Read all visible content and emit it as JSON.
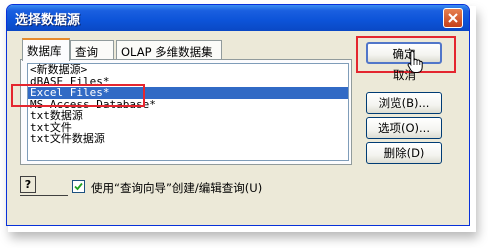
{
  "window": {
    "title": "选择数据源"
  },
  "tabs": [
    {
      "label": "数据库",
      "mnemonic": "D",
      "active": true
    },
    {
      "label": "查询",
      "mnemonic": "Q",
      "active": false
    },
    {
      "label": "OLAP 多维数据集",
      "mnemonic": "O",
      "active": false
    }
  ],
  "data_sources": [
    {
      "label": "<新数据源>",
      "selected": false
    },
    {
      "label": "dBASE Files*",
      "selected": false
    },
    {
      "label": "Excel Files*",
      "selected": true
    },
    {
      "label": "MS Access Database*",
      "selected": false
    },
    {
      "label": "txt数据源",
      "selected": false
    },
    {
      "label": "txt文件",
      "selected": false
    },
    {
      "label": "txt文件数据源",
      "selected": false
    }
  ],
  "buttons": {
    "ok": "确定",
    "cancel": "取消",
    "browse": "浏览(B)...",
    "options": "选项(O)...",
    "delete": "删除(D)"
  },
  "footer": {
    "help_glyph": "?",
    "use_query_wizard_label": "使用“查询向导”创建/编辑查询(U)",
    "use_query_wizard_checked": true
  },
  "colors": {
    "title_bar": "#0c53d8",
    "selection": "#316ac5",
    "annotation_red": "#e4262f",
    "dialog_bg": "#ece9d8"
  }
}
